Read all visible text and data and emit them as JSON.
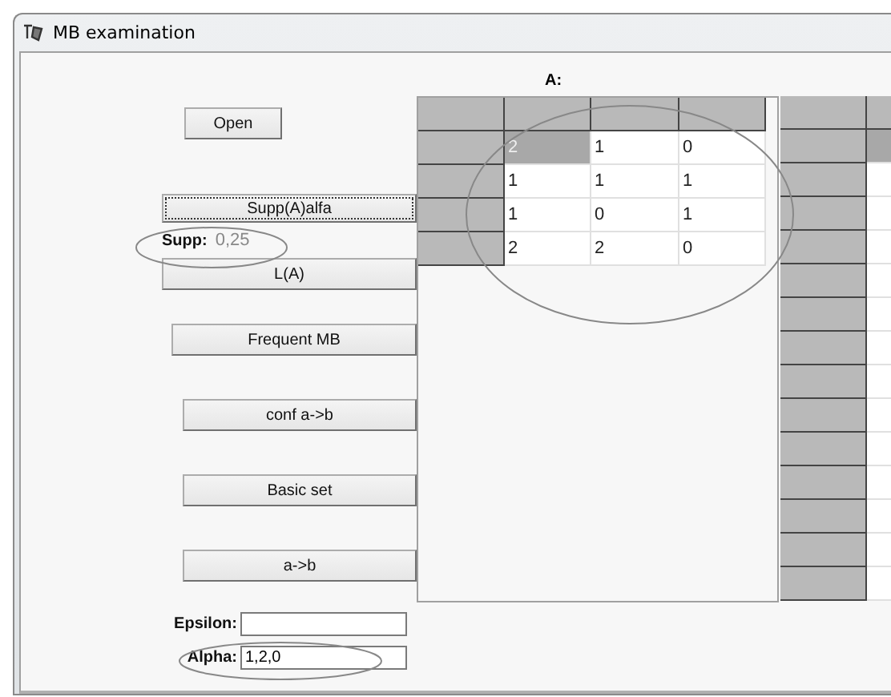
{
  "window": {
    "title": "MB examination"
  },
  "buttons": [
    {
      "label": "Open",
      "focused": false
    },
    {
      "label": "Supp(A)alfa",
      "focused": true
    },
    {
      "label": "L(A)",
      "focused": false
    },
    {
      "label": "Frequent MB",
      "focused": false
    },
    {
      "label": "conf a->b",
      "focused": false
    },
    {
      "label": "Basic set",
      "focused": false
    },
    {
      "label": "a->b",
      "focused": false
    }
  ],
  "supp": {
    "label": "Supp:",
    "value": "0,25",
    "highlighted": true
  },
  "fields": [
    {
      "label": "Epsilon:",
      "highlighted": false
    },
    {
      "label": "Alpha:",
      "value": "1,2,0",
      "highlighted": true
    }
  ],
  "grid_a": {
    "label": "A:",
    "highlighted": true,
    "rows": [
      {
        "cells": [
          {
            "text": "2",
            "selected": true
          },
          {
            "text": "1",
            "selected": false
          },
          {
            "text": "0",
            "selected": false
          }
        ]
      },
      {
        "cells": [
          {
            "text": "1",
            "selected": false
          },
          {
            "text": "1",
            "selected": false
          },
          {
            "text": "1",
            "selected": false
          }
        ]
      },
      {
        "cells": [
          {
            "text": "1",
            "selected": false
          },
          {
            "text": "0",
            "selected": false
          },
          {
            "text": "1",
            "selected": false
          }
        ]
      },
      {
        "cells": [
          {
            "text": "2",
            "selected": false
          },
          {
            "text": "2",
            "selected": false
          },
          {
            "text": "0",
            "selected": false
          }
        ]
      }
    ]
  },
  "grid_b": {
    "rows": [
      {
        "selected": true
      },
      {
        "selected": false
      },
      {
        "selected": false
      },
      {
        "selected": false
      },
      {
        "selected": false
      },
      {
        "selected": false
      },
      {
        "selected": false
      },
      {
        "selected": false
      },
      {
        "selected": false
      },
      {
        "selected": false
      },
      {
        "selected": false
      },
      {
        "selected": false
      },
      {
        "selected": false
      },
      {
        "selected": false
      }
    ]
  }
}
